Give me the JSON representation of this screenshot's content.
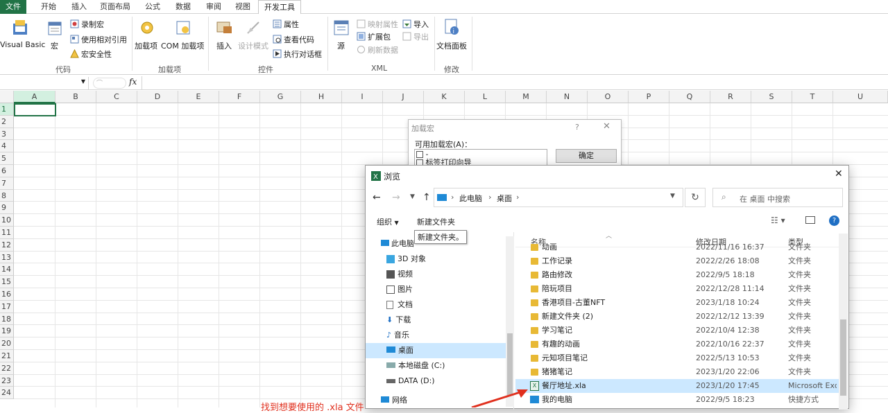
{
  "ribbon_tabs": [
    "文件",
    "开始",
    "插入",
    "页面布局",
    "公式",
    "数据",
    "审阅",
    "视图",
    "开发工具"
  ],
  "ribbon": {
    "code": {
      "visual_basic": "Visual Basic",
      "macros": "宏",
      "record": "录制宏",
      "relative": "使用相对引用",
      "security": "宏安全性",
      "label": "代码"
    },
    "addins": {
      "addins": "加载项",
      "com": "COM 加载项",
      "label": "加载项"
    },
    "controls": {
      "insert": "插入",
      "design": "设计模式",
      "properties": "属性",
      "view_code": "查看代码",
      "run_dialog": "执行对话框",
      "label": "控件"
    },
    "xml": {
      "source": "源",
      "map_props": "映射属性",
      "expansion": "扩展包",
      "refresh": "刷新数据",
      "import": "导入",
      "export": "导出",
      "label": "XML"
    },
    "modify": {
      "doc_panel": "文档面板",
      "label": "修改"
    }
  },
  "formula_bar": {
    "fx": "fx",
    "value": ""
  },
  "columns": [
    "A",
    "B",
    "C",
    "D",
    "E",
    "F",
    "G",
    "H",
    "I",
    "J",
    "K",
    "L",
    "M",
    "N",
    "O",
    "P",
    "Q",
    "R",
    "S",
    "T",
    "U"
  ],
  "rows": [
    "1",
    "2",
    "3",
    "4",
    "5",
    "6",
    "7",
    "8",
    "9",
    "10",
    "11",
    "12",
    "13",
    "14",
    "15",
    "16",
    "17",
    "18",
    "19",
    "20",
    "21",
    "22",
    "23",
    "24"
  ],
  "addin_dialog": {
    "title": "加载宏",
    "help": "?",
    "list_label": "可用加载宏(A)：",
    "items": [
      "-",
      "标签打印向导"
    ],
    "ok": "确定"
  },
  "browse_dialog": {
    "title": "浏览",
    "path": [
      "此电脑",
      "桌面"
    ],
    "search_placeholder": "在 桌面 中搜索",
    "organize": "组织",
    "new_folder": "新建文件夹",
    "tooltip": "新建文件夹。",
    "nav": [
      "此电脑",
      "3D 对象",
      "视频",
      "图片",
      "文档",
      "下载",
      "音乐",
      "桌面",
      "本地磁盘 (C:)",
      "DATA (D:)",
      "网络"
    ],
    "headers": {
      "name": "名称",
      "date": "修改日期",
      "type": "类型"
    },
    "files": [
      {
        "name": "动画",
        "date": "2022/11/16 16:37",
        "type": "文件夹",
        "kind": "folder"
      },
      {
        "name": "工作记录",
        "date": "2022/2/26 18:08",
        "type": "文件夹",
        "kind": "folder"
      },
      {
        "name": "路由修改",
        "date": "2022/9/5 18:18",
        "type": "文件夹",
        "kind": "folder"
      },
      {
        "name": "陪玩项目",
        "date": "2022/12/28 11:14",
        "type": "文件夹",
        "kind": "folder"
      },
      {
        "name": "香港项目-古董NFT",
        "date": "2023/1/18 10:24",
        "type": "文件夹",
        "kind": "folder"
      },
      {
        "name": "新建文件夹 (2)",
        "date": "2022/12/12 13:39",
        "type": "文件夹",
        "kind": "folder"
      },
      {
        "name": "学习笔记",
        "date": "2022/10/4 12:38",
        "type": "文件夹",
        "kind": "folder"
      },
      {
        "name": "有趣的动画",
        "date": "2022/10/16 22:37",
        "type": "文件夹",
        "kind": "folder"
      },
      {
        "name": "元知项目笔记",
        "date": "2022/5/13 10:53",
        "type": "文件夹",
        "kind": "folder"
      },
      {
        "name": "猪猪笔记",
        "date": "2023/1/20 22:06",
        "type": "文件夹",
        "kind": "folder"
      },
      {
        "name": "餐厅地址.xla",
        "date": "2023/1/20 17:45",
        "type": "Microsoft Excel",
        "kind": "xla"
      },
      {
        "name": "我的电脑",
        "date": "2022/9/5 18:23",
        "type": "快捷方式",
        "kind": "shortcut"
      }
    ]
  },
  "annotation": "找到想要使用的 .xla 文件",
  "colors": {
    "excel_green": "#217346",
    "selected_row": "#cce8ff",
    "arrow": "#e0301e"
  }
}
